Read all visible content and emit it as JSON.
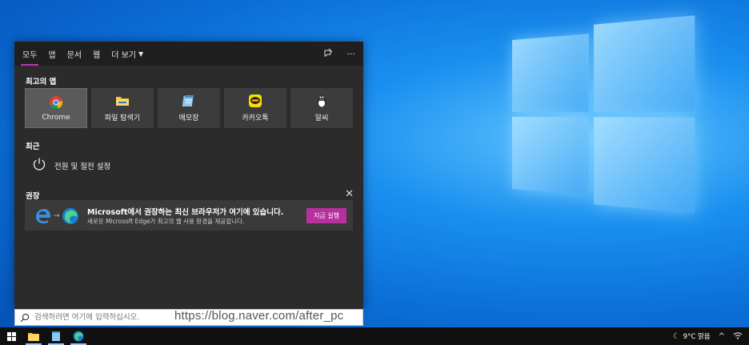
{
  "tabs": [
    {
      "label": "모두",
      "active": true
    },
    {
      "label": "앱"
    },
    {
      "label": "문서"
    },
    {
      "label": "웹"
    },
    {
      "label": "더 보기"
    }
  ],
  "header_more": "···",
  "top_apps": {
    "title": "최고의 앱",
    "items": [
      {
        "label": "Chrome",
        "icon": "chrome-icon"
      },
      {
        "label": "파일 탐색기",
        "icon": "file-explorer-icon"
      },
      {
        "label": "메모장",
        "icon": "notepad-icon"
      },
      {
        "label": "카카오톡",
        "icon": "kakaotalk-icon"
      },
      {
        "label": "알씨",
        "icon": "alsee-icon"
      }
    ]
  },
  "recent": {
    "title": "최근",
    "items": [
      {
        "label": "전원 및 절전 설정",
        "icon": "power-icon"
      }
    ]
  },
  "recommended": {
    "title": "권장",
    "close": "✕",
    "card_title": "Microsoft에서 권장하는 최신 브라우저가 여기에 있습니다.",
    "card_desc": "새로운 Microsoft Edge가 최고의 웹 사용 환경을 제공합니다.",
    "button": "지금 실행"
  },
  "search": {
    "placeholder": "검색하려면 여기에 입력하십시오."
  },
  "watermark": "https://blog.naver.com/after_pc",
  "tray": {
    "weather": "9°C 맑음",
    "chevron": "^"
  },
  "colors": {
    "accent": "#c230b8",
    "button": "#b6309f",
    "panel": "#2b2b2b"
  }
}
